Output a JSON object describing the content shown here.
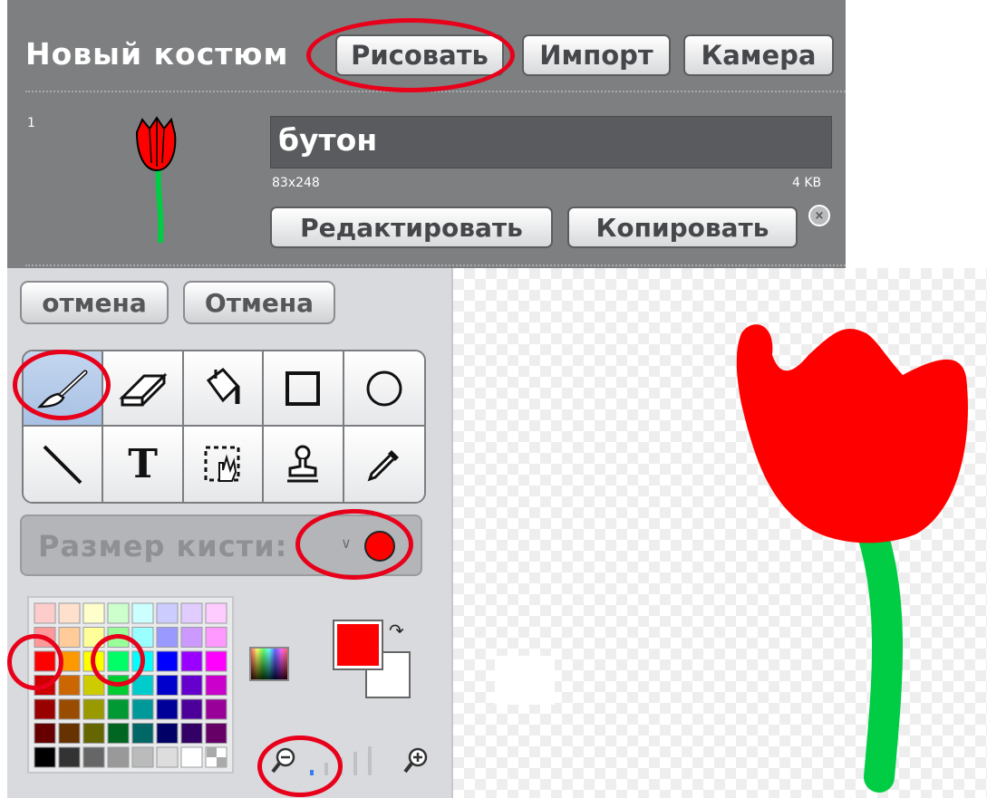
{
  "costume_panel": {
    "title": "Новый костюм",
    "paint_button": "Рисовать",
    "import_button": "Импорт",
    "camera_button": "Камера",
    "costume": {
      "number": "1",
      "name": "бутон",
      "size": "83x248",
      "file_size": "4 KB",
      "edit_button": "Редактировать",
      "copy_button": "Копировать",
      "delete_icon": "close-circle-icon"
    }
  },
  "paint_editor": {
    "undo_button": "отмена",
    "cancel_button": "Отмена",
    "tools": [
      {
        "icon": "brush-icon",
        "active": true
      },
      {
        "icon": "eraser-icon",
        "active": false
      },
      {
        "icon": "fill-bucket-icon",
        "active": false
      },
      {
        "icon": "rectangle-icon",
        "active": false
      },
      {
        "icon": "ellipse-icon",
        "active": false
      },
      {
        "icon": "line-icon",
        "active": false
      },
      {
        "icon": "text-icon",
        "active": false
      },
      {
        "icon": "select-icon",
        "active": false
      },
      {
        "icon": "stamp-icon",
        "active": false
      },
      {
        "icon": "eyedropper-icon",
        "active": false
      }
    ],
    "text_tool_glyph": "T",
    "brush_size_label": "Размер кисти:",
    "brush_color": "#ff0000",
    "foreground_color": "#ff0000",
    "background_color": "#ffffff",
    "palette": [
      [
        "#ffcccc",
        "#ffe0cc",
        "#ffffcc",
        "#ccffcc",
        "#ccffff",
        "#ccccff",
        "#e0ccff",
        "#ffccff"
      ],
      [
        "#ff9999",
        "#ffcc99",
        "#ffff99",
        "#99ff99",
        "#99ffff",
        "#9999ff",
        "#cc99ff",
        "#ff99ff"
      ],
      [
        "#ff0000",
        "#ff9900",
        "#ffff00",
        "#00ff66",
        "#00ffff",
        "#0000ff",
        "#9900ff",
        "#ff00ff"
      ],
      [
        "#cc0000",
        "#cc6600",
        "#cccc00",
        "#00cc33",
        "#00cccc",
        "#0000cc",
        "#6600cc",
        "#cc00cc"
      ],
      [
        "#990000",
        "#994c00",
        "#999900",
        "#009933",
        "#009999",
        "#000099",
        "#4c0099",
        "#990099"
      ],
      [
        "#660000",
        "#663300",
        "#666600",
        "#006622",
        "#006666",
        "#000066",
        "#330066",
        "#660066"
      ],
      [
        "#000000",
        "#333333",
        "#666666",
        "#999999",
        "#bbbbbb",
        "#dddddd",
        "#ffffff",
        "checker"
      ]
    ]
  },
  "colors": {
    "annotation_red": "#e8001b",
    "tulip_red": "#ff0000",
    "stem_green": "#00cc44"
  }
}
